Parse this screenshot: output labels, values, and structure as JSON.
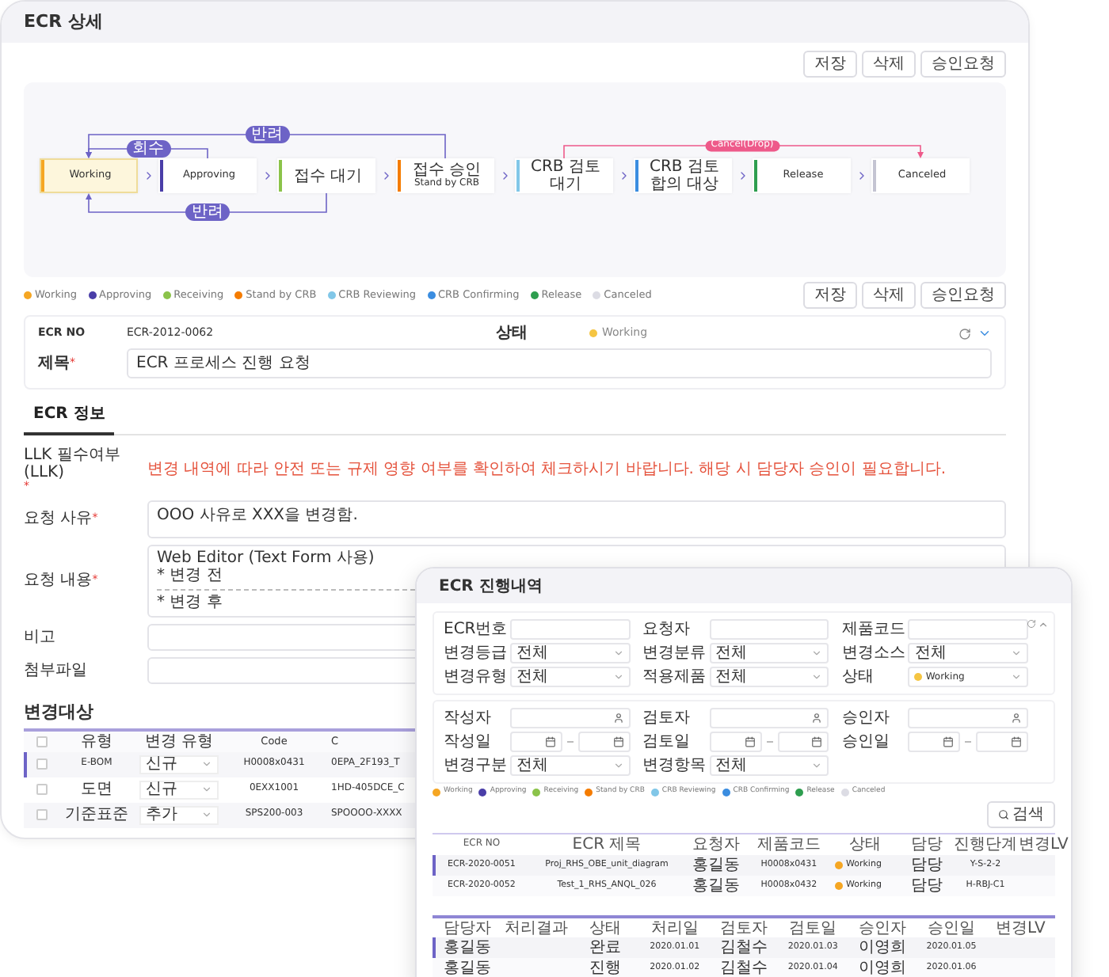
{
  "main_window": {
    "title": "ECR 상세",
    "top_buttons": [
      "저장",
      "삭제",
      "승인요청"
    ],
    "flow": {
      "nodes": [
        {
          "label": "Working",
          "color": "#f5a623",
          "selected": true
        },
        {
          "label": "Approving",
          "color": "#4a3ea8",
          "selected": false
        },
        {
          "label": "접수 대기",
          "color": "#8bc34a",
          "selected": false
        },
        {
          "label": "접수 승인",
          "sublabel": "Stand by CRB",
          "color": "#f57c00",
          "selected": false
        },
        {
          "label": "CRB 검토 대기",
          "color": "#81c7e8",
          "selected": false
        },
        {
          "label": "CRB 검토 합의 대상",
          "color": "#3b8de0",
          "selected": false
        },
        {
          "label": "Release",
          "color": "#2e9e4f",
          "selected": false
        },
        {
          "label": "Canceled",
          "color": "#c4c4d2",
          "selected": false
        }
      ],
      "links": [
        {
          "label": "회수",
          "kind": "recall"
        },
        {
          "label": "반려",
          "kind": "reject_top"
        },
        {
          "label": "반려",
          "kind": "reject_bottom"
        },
        {
          "label": "Cancel(Drop)",
          "kind": "cancel"
        }
      ]
    },
    "legend": [
      {
        "label": "Working",
        "color": "#f5a623"
      },
      {
        "label": "Approving",
        "color": "#4a3ea8"
      },
      {
        "label": "Receiving",
        "color": "#8bc34a"
      },
      {
        "label": "Stand by CRB",
        "color": "#f57c00"
      },
      {
        "label": "CRB Reviewing",
        "color": "#81c7e8"
      },
      {
        "label": "CRB Confirming",
        "color": "#3b8de0"
      },
      {
        "label": "Release",
        "color": "#2e9e4f"
      },
      {
        "label": "Canceled",
        "color": "#dcdce4"
      }
    ],
    "second_buttons": [
      "저장",
      "삭제",
      "승인요청"
    ],
    "info": {
      "ecr_no_label": "ECR NO",
      "ecr_no": "ECR-2012-0062",
      "status_label": "상태",
      "status": {
        "label": "Working",
        "color": "#f5c542"
      },
      "title_label": "제목",
      "title_required": "*",
      "title_value": "ECR 프로세스 진행 요청"
    },
    "tabs": [
      {
        "label": "ECR 정보",
        "selected": true
      }
    ],
    "form": [
      {
        "kind": "note",
        "label": "LLK 필수여부 (LLK)",
        "required": "*",
        "text": "변경 내역에 따라 안전 또는 규제 영향 여부를 확인하여 체크하시기 바랍니다. 해당 시 담당자 승인이 필요합니다."
      },
      {
        "kind": "textarea",
        "label": "요청 사유",
        "required": "*",
        "value": "OOO 사유로 XXX을 변경함."
      },
      {
        "kind": "editor",
        "label": "요청 내용",
        "required": "*",
        "lines": [
          {
            "kind": "text",
            "text": "Web Editor (Text Form 사용)"
          },
          {
            "kind": "text",
            "text": "* 변경 전"
          },
          {
            "kind": "rule"
          },
          {
            "kind": "text",
            "text": "* 변경 후"
          }
        ]
      },
      {
        "kind": "input",
        "label": "비고"
      },
      {
        "kind": "input",
        "label": "첨부파일"
      }
    ],
    "changes": {
      "title": "변경대상",
      "header_checked": false,
      "columns": [
        "유형",
        "변경 유형",
        "Code",
        "C"
      ],
      "rows": [
        {
          "type": "E-BOM",
          "change_type": "신규",
          "code": "H0008x0431",
          "column_5": "0EPA_2F193_T",
          "selected": true,
          "checked": false
        },
        {
          "type": "도면",
          "change_type": "신규",
          "code": "0EXX1001",
          "column_5": "1HD-405DCE_C",
          "selected": false,
          "checked": false
        },
        {
          "type": "기준표준",
          "change_type": "추가",
          "code": "SPS200-003",
          "column_5": "SPOOOO-XXXX",
          "selected": false,
          "checked": false
        }
      ]
    }
  },
  "history_window": {
    "title": "ECR 진행내역",
    "filter_groups": [
      [
        {
          "label": "ECR번호",
          "kind": "text"
        },
        {
          "label": "요청자",
          "kind": "text"
        },
        {
          "label": "제품코드",
          "kind": "text"
        },
        {
          "label": "변경등급",
          "kind": "select",
          "value": "전체"
        },
        {
          "label": "변경분류",
          "kind": "select",
          "value": "전체"
        },
        {
          "label": "변경소스",
          "kind": "select",
          "value": "전체"
        },
        {
          "label": "변경유형",
          "kind": "select",
          "value": "전체"
        },
        {
          "label": "적용제품",
          "kind": "select",
          "value": "전체"
        },
        {
          "label": "상태",
          "kind": "select",
          "value": "Working",
          "color": "#f5c542"
        }
      ],
      [
        {
          "label": "작성자",
          "kind": "person"
        },
        {
          "label": "검토자",
          "kind": "person"
        },
        {
          "label": "승인자",
          "kind": "person"
        },
        {
          "label": "작성일",
          "kind": "daterange"
        },
        {
          "label": "검토일",
          "kind": "daterange"
        },
        {
          "label": "승인일",
          "kind": "daterange"
        },
        {
          "label": "변경구분",
          "kind": "select",
          "value": "전체"
        },
        {
          "label": "변경항목",
          "kind": "select",
          "value": "전체"
        }
      ]
    ],
    "legend": [
      {
        "label": "Working",
        "color": "#f5a623"
      },
      {
        "label": "Approving",
        "color": "#4a3ea8"
      },
      {
        "label": "Receiving",
        "color": "#8bc34a"
      },
      {
        "label": "Stand by CRB",
        "color": "#f57c00"
      },
      {
        "label": "CRB Reviewing",
        "color": "#81c7e8"
      },
      {
        "label": "CRB Confirming",
        "color": "#3b8de0"
      },
      {
        "label": "Release",
        "color": "#2e9e4f"
      },
      {
        "label": "Canceled",
        "color": "#dcdce4"
      }
    ],
    "search_button": "검색",
    "progress_table": {
      "columns": [
        "ECR NO",
        "ECR 제목",
        "요청자",
        "제품코드",
        "상태",
        "담당",
        "진행단계",
        "변경LV"
      ],
      "rows": [
        {
          "selected": true,
          "cells": [
            "ECR-2020-0051",
            "Proj_RHS_OBE_unit_diagram",
            "홍길동",
            "H0008x0431",
            {
              "text": "Working",
              "color": "#f5a623"
            },
            "담당",
            "Y-S-2-2",
            null
          ]
        },
        {
          "selected": false,
          "cells": [
            "ECR-2020-0052",
            "Test_1_RHS_ANQL_026",
            "홍길동",
            "H0008x0432",
            {
              "text": "Working",
              "color": "#f5a623"
            },
            "담당",
            "H-RBJ-C1",
            null
          ]
        }
      ]
    },
    "approval_table": {
      "columns": [
        "담당자",
        "처리결과",
        "상태",
        "처리일",
        "검토자",
        "검토일",
        "승인자",
        "승인일",
        "변경LV"
      ],
      "rows": [
        {
          "selected": true,
          "cells": [
            "홍길동",
            null,
            "완료",
            "2020.01.01",
            "김철수",
            "2020.01.03",
            "이영희",
            "2020.01.05",
            null
          ]
        },
        {
          "selected": false,
          "cells": [
            "홍길동",
            null,
            "진행",
            "2020.01.02",
            "김철수",
            "2020.01.04",
            "이영희",
            "2020.01.06",
            null
          ]
        }
      ]
    }
  }
}
